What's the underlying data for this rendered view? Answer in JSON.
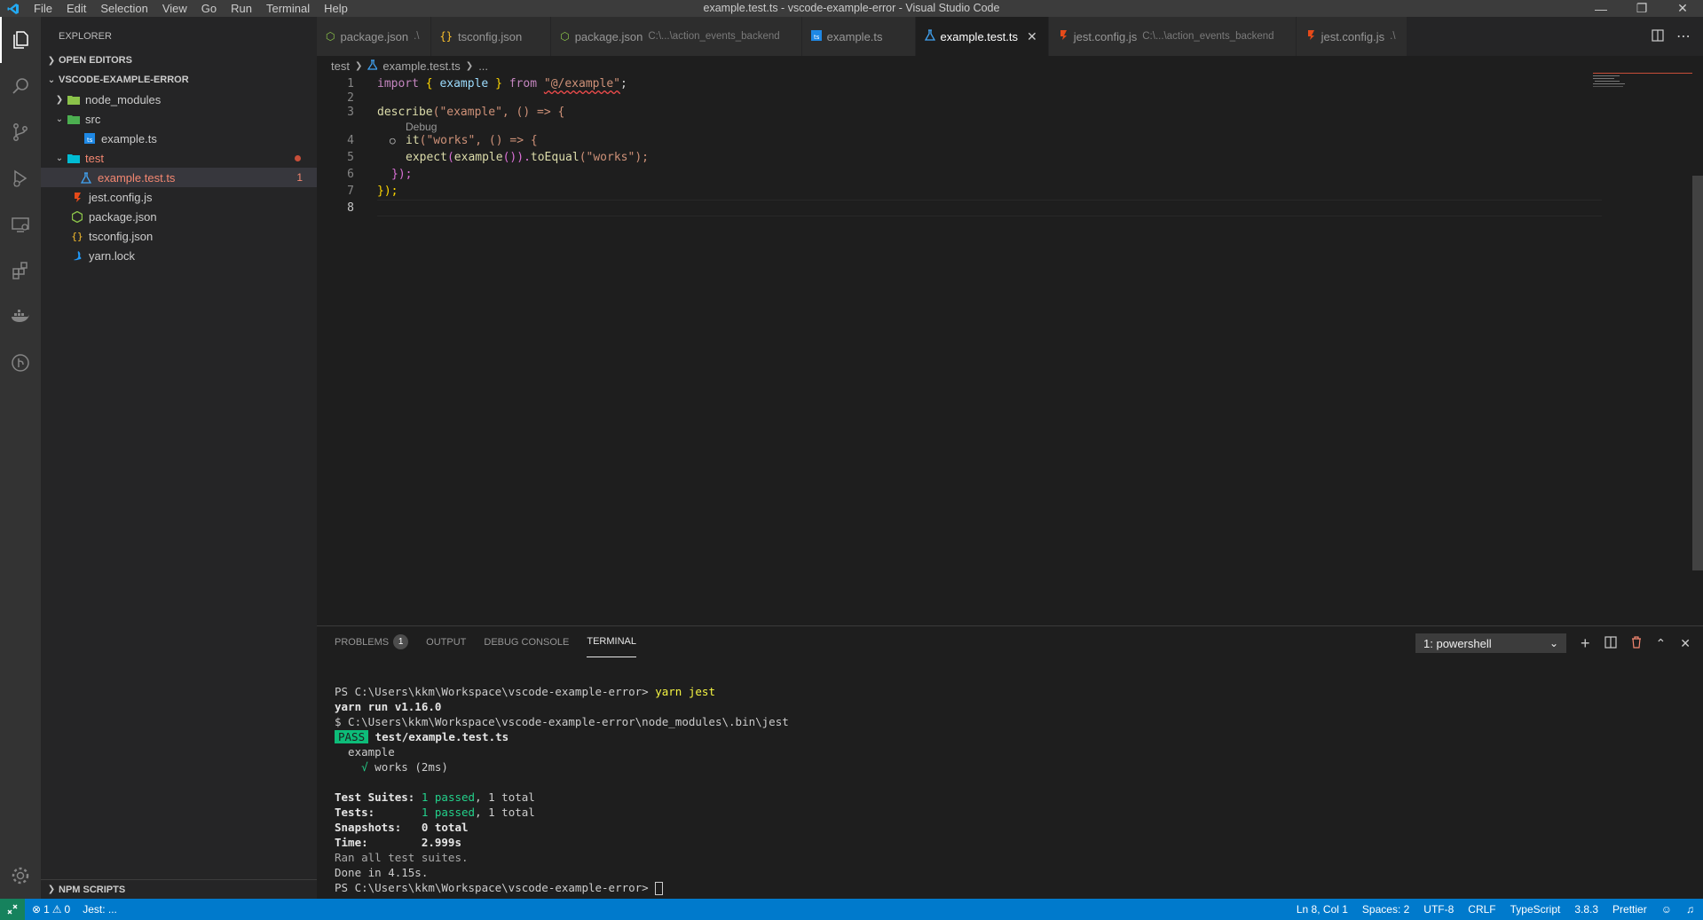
{
  "window": {
    "title": "example.test.ts - vscode-example-error - Visual Studio Code",
    "menu": [
      "File",
      "Edit",
      "Selection",
      "View",
      "Go",
      "Run",
      "Terminal",
      "Help"
    ]
  },
  "sidebar": {
    "title": "EXPLORER",
    "open_editors": "OPEN EDITORS",
    "project": "VSCODE-EXAMPLE-ERROR",
    "tree": [
      {
        "label": "node_modules"
      },
      {
        "label": "src"
      },
      {
        "label": "example.ts"
      },
      {
        "label": "test"
      },
      {
        "label": "example.test.ts",
        "problems": "1"
      },
      {
        "label": "jest.config.js"
      },
      {
        "label": "package.json"
      },
      {
        "label": "tsconfig.json"
      },
      {
        "label": "yarn.lock"
      }
    ],
    "npm_scripts": "NPM SCRIPTS"
  },
  "tabs": [
    {
      "label": "package.json",
      "desc": ".\\"
    },
    {
      "label": "tsconfig.json",
      "desc": ""
    },
    {
      "label": "package.json",
      "desc": "C:\\...\\action_events_backend"
    },
    {
      "label": "example.ts",
      "desc": ""
    },
    {
      "label": "example.test.ts",
      "desc": ""
    },
    {
      "label": "jest.config.js",
      "desc": "C:\\...\\action_events_backend"
    },
    {
      "label": "jest.config.js",
      "desc": ".\\"
    }
  ],
  "breadcrumb": {
    "folder": "test",
    "file": "example.test.ts",
    "more": "..."
  },
  "editor": {
    "line_numbers": [
      "1",
      "2",
      "3",
      "4",
      "5",
      "6",
      "7",
      "8"
    ],
    "codelens": "Debug",
    "code": {
      "l1_import": "import",
      "l1_open": " { ",
      "l1_name": "example",
      "l1_close": " } ",
      "l1_from": "from",
      "l1_path": "\"@/example\"",
      "l1_semi": ";",
      "l3_fn": "describe",
      "l3_args": "(\"example\", () => {",
      "l4_fn": "it",
      "l4_args": "(\"works\", () => {",
      "l5_expect": "expect",
      "l5_p1": "(",
      "l5_example": "example",
      "l5_p2": "()).",
      "l5_toequal": "toEqual",
      "l5_args": "(\"works\");",
      "l6": "});",
      "l7": "});"
    }
  },
  "panel": {
    "tabs": [
      "PROBLEMS",
      "OUTPUT",
      "DEBUG CONSOLE",
      "TERMINAL"
    ],
    "problems_count": "1",
    "terminal_select": "1: powershell",
    "terminal": {
      "prompt1": "PS C:\\Users\\kkm\\Workspace\\vscode-example-error> ",
      "cmd": "yarn jest",
      "yarn_run": "yarn run v1.16.0",
      "bin": "$ C:\\Users\\kkm\\Workspace\\vscode-example-error\\node_modules\\.bin\\jest",
      "pass": "PASS",
      "pass_file": " test/example.test.ts",
      "suite": "  example",
      "check": "    √",
      "test_name": " works (2ms)",
      "suites_label": "Test Suites: ",
      "suites_passed": "1 passed",
      "suites_total": ", 1 total",
      "tests_label": "Tests:       ",
      "tests_passed": "1 passed",
      "tests_total": ", 1 total",
      "snapshots": "Snapshots:   0 total",
      "time": "Time:        2.999s",
      "ran": "Ran all test suites.",
      "done": "Done in 4.15s.",
      "prompt2": "PS C:\\Users\\kkm\\Workspace\\vscode-example-error> "
    }
  },
  "statusbar": {
    "errors": "1",
    "warnings": "0",
    "jest": "Jest: ...",
    "position": "Ln 8, Col 1",
    "spaces": "Spaces: 2",
    "encoding": "UTF-8",
    "eol": "CRLF",
    "language": "TypeScript",
    "version": "3.8.3",
    "formatter": "Prettier"
  },
  "colors": {
    "accent": "#007acc",
    "pass": "#0dbc79",
    "error": "#f48771"
  }
}
